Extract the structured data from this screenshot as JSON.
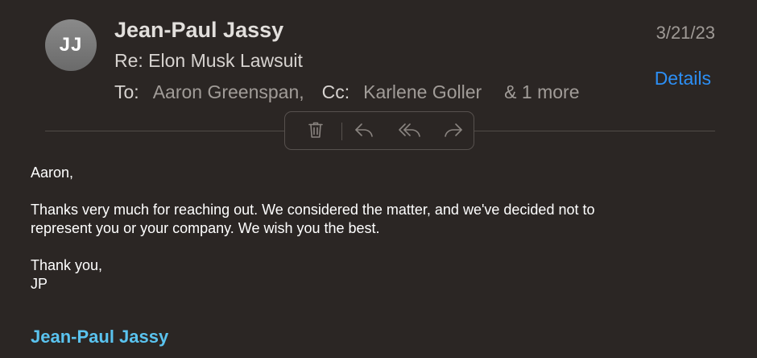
{
  "header": {
    "avatar_initials": "JJ",
    "sender_name": "Jean-Paul Jassy",
    "subject": "Re: Elon Musk Lawsuit",
    "date": "3/21/23",
    "details_label": "Details",
    "to_label": "To:",
    "to_name": "Aaron Greenspan,",
    "cc_label": "Cc:",
    "cc_name": "Karlene Goller",
    "more_label": "& 1 more"
  },
  "toolbar": {
    "icons": [
      "trash-icon",
      "reply-icon",
      "reply-all-icon",
      "forward-icon"
    ]
  },
  "body": {
    "greeting": "Aaron,",
    "paragraph_line1": "Thanks very much for reaching out.  We considered the matter, and we've decided not to",
    "paragraph_line2": "represent you or your company.  We wish you the best.",
    "closing": "Thank you,",
    "initials": "JP"
  },
  "signature": {
    "name": "Jean-Paul Jassy"
  },
  "colors": {
    "background": "#2b2624",
    "link_blue": "#2c8ff5",
    "signature_cyan": "#5ac3ef"
  }
}
